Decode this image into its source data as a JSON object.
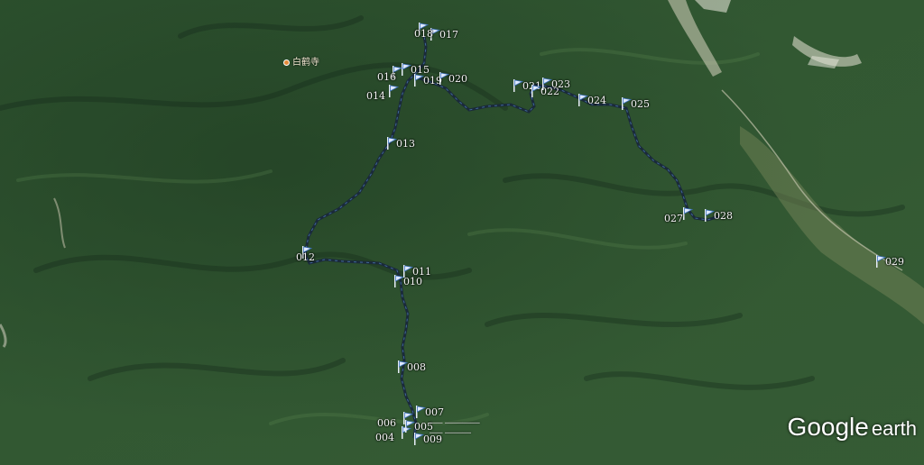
{
  "map": {
    "logo": {
      "brand": "Google",
      "product": "earth"
    },
    "poi": {
      "label": "白鹤寺"
    },
    "track_color": "#1a2a3a",
    "waypoints": [
      {
        "id": "wp004",
        "label": "004"
      },
      {
        "id": "wp005",
        "label": "005"
      },
      {
        "id": "wp006",
        "label": "006"
      },
      {
        "id": "wp007",
        "label": "007"
      },
      {
        "id": "wp008",
        "label": "008"
      },
      {
        "id": "wp009",
        "label": "009"
      },
      {
        "id": "wp010",
        "label": "010"
      },
      {
        "id": "wp011",
        "label": "011"
      },
      {
        "id": "wp012",
        "label": "012"
      },
      {
        "id": "wp013",
        "label": "013"
      },
      {
        "id": "wp014",
        "label": "014"
      },
      {
        "id": "wp015",
        "label": "015"
      },
      {
        "id": "wp016",
        "label": "016"
      },
      {
        "id": "wp017",
        "label": "017"
      },
      {
        "id": "wp018",
        "label": "018"
      },
      {
        "id": "wp019",
        "label": "019"
      },
      {
        "id": "wp020",
        "label": "020"
      },
      {
        "id": "wp021",
        "label": "021"
      },
      {
        "id": "wp022",
        "label": "022"
      },
      {
        "id": "wp023",
        "label": "023"
      },
      {
        "id": "wp024",
        "label": "024"
      },
      {
        "id": "wp025",
        "label": "025"
      },
      {
        "id": "wp027",
        "label": "027"
      },
      {
        "id": "wp028",
        "label": "028"
      },
      {
        "id": "wp029",
        "label": "029"
      }
    ]
  }
}
